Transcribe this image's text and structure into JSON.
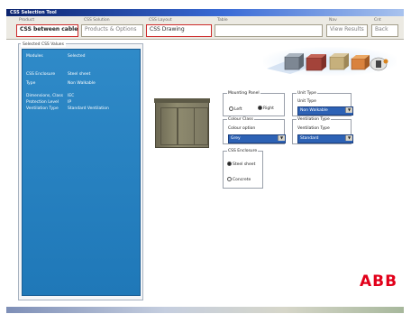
{
  "window": {
    "title": "CSS Selection Tool"
  },
  "wizard": {
    "steps": [
      {
        "label": "Product",
        "value": "CSS between cables",
        "state": "active"
      },
      {
        "label": "CSS Solution",
        "value": "Products & Options",
        "state": ""
      },
      {
        "label": "CSS Layout",
        "value": "CSS Drawing",
        "state": "current"
      },
      {
        "label": "Table",
        "value": "",
        "state": ""
      },
      {
        "label": "Nav",
        "value": "View Results",
        "state": ""
      },
      {
        "label": "Cnt",
        "value": "Back",
        "state": ""
      }
    ]
  },
  "sidebar": {
    "title": "Selected CSS Values",
    "rows": [
      {
        "k": "Modules",
        "v": "Selected"
      },
      {
        "k": "CSS Enclosure",
        "v": "Steel sheet"
      },
      {
        "k": "Type",
        "v": "Non Walkable"
      },
      {
        "k": "Dimensions, Class",
        "v": "IEC"
      },
      {
        "k": "Protection Level",
        "v": "IP"
      },
      {
        "k": "Ventilation Type",
        "v": "Standard Ventilation"
      }
    ]
  },
  "options": {
    "mounting": {
      "title": "Mounting Panel",
      "opt1": "Left",
      "opt2": "Right",
      "selected": "opt2"
    },
    "unit_type": {
      "title": "Unit Type",
      "field_label": "Unit Type",
      "value": "Non Walkable"
    },
    "colour": {
      "title": "Colour Class",
      "field_label": "Colour option",
      "value": "Grey"
    },
    "ventilation": {
      "title": "Ventilation Type",
      "field_label": "Ventilation Type",
      "value": "Standard"
    },
    "enclosure": {
      "title": "CSS Enclosure",
      "opt1": "Steel sheet",
      "opt2": "Concrete",
      "selected": "opt1"
    }
  },
  "brand": {
    "logo_text": "ABB",
    "color": "#e2001a"
  },
  "colors": {
    "accent": "#1f78b8",
    "wizard_active": "#cc2a2a",
    "select_fill": "#2d62b5"
  },
  "icons": {
    "dropdown": "chevron-down-icon",
    "radio": "radio-icon"
  }
}
